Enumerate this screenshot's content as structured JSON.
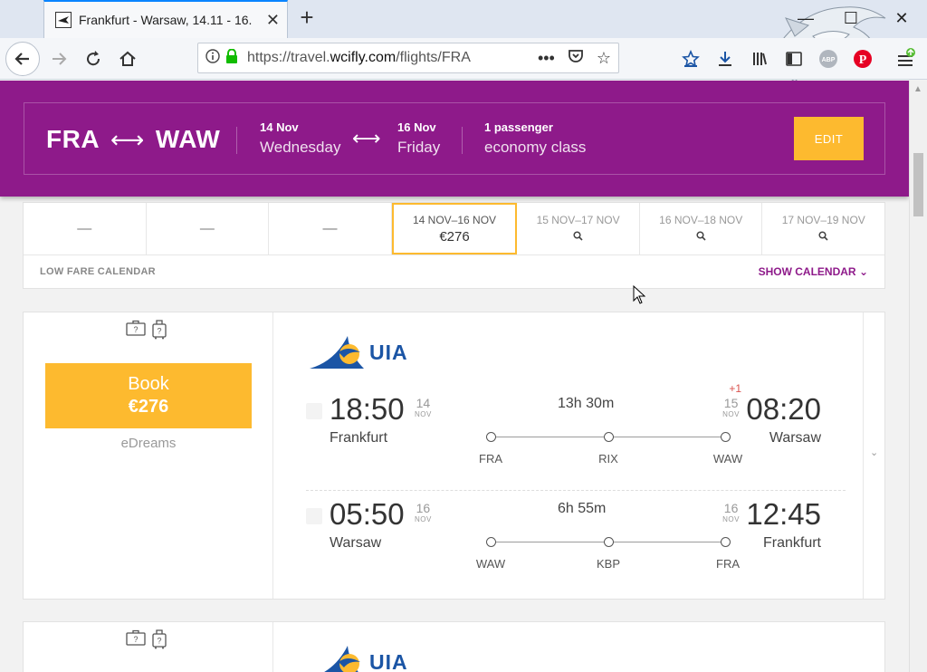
{
  "browser": {
    "tab_title": "Frankfurt - Warsaw, 14.11 - 16.",
    "url_prefix": "https://travel.",
    "url_domain": "wcifly.com",
    "url_suffix": "/flights/FRA"
  },
  "search": {
    "from": "FRA",
    "to": "WAW",
    "depart_date": "14 Nov",
    "depart_weekday": "Wednesday",
    "return_date": "16 Nov",
    "return_weekday": "Friday",
    "passengers": "1 passenger",
    "cabin": "economy class",
    "edit_label": "EDIT"
  },
  "calendar": {
    "cells": [
      {
        "label": "—"
      },
      {
        "label": "—"
      },
      {
        "label": "—"
      },
      {
        "label": "14 NOV–16 NOV",
        "price": "€276",
        "selected": true
      },
      {
        "label": "15 NOV–17 NOV"
      },
      {
        "label": "16 NOV–18 NOV"
      },
      {
        "label": "17 NOV–19 NOV"
      }
    ],
    "footer_label": "LOW FARE CALENDAR",
    "show_calendar": "SHOW CALENDAR"
  },
  "results": [
    {
      "book_label": "Book",
      "price": "€276",
      "provider": "eDreams",
      "airline": "UIA",
      "legs": [
        {
          "dep_time": "18:50",
          "dep_day": "14",
          "dep_month": "NOV",
          "dep_city": "Frankfurt",
          "arr_time": "08:20",
          "arr_day": "15",
          "arr_month": "NOV",
          "arr_city": "Warsaw",
          "day_offset": "+1",
          "duration": "13h 30m",
          "stops": [
            "FRA",
            "RIX",
            "WAW"
          ]
        },
        {
          "dep_time": "05:50",
          "dep_day": "16",
          "dep_month": "NOV",
          "dep_city": "Warsaw",
          "arr_time": "12:45",
          "arr_day": "16",
          "arr_month": "NOV",
          "arr_city": "Frankfurt",
          "duration": "6h 55m",
          "stops": [
            "WAW",
            "KBP",
            "FRA"
          ]
        }
      ]
    },
    {
      "airline": "UIA"
    }
  ],
  "colors": {
    "brand_purple": "#8e1a8a",
    "accent_yellow": "#fdba2f",
    "airline_blue": "#1b55a5"
  }
}
